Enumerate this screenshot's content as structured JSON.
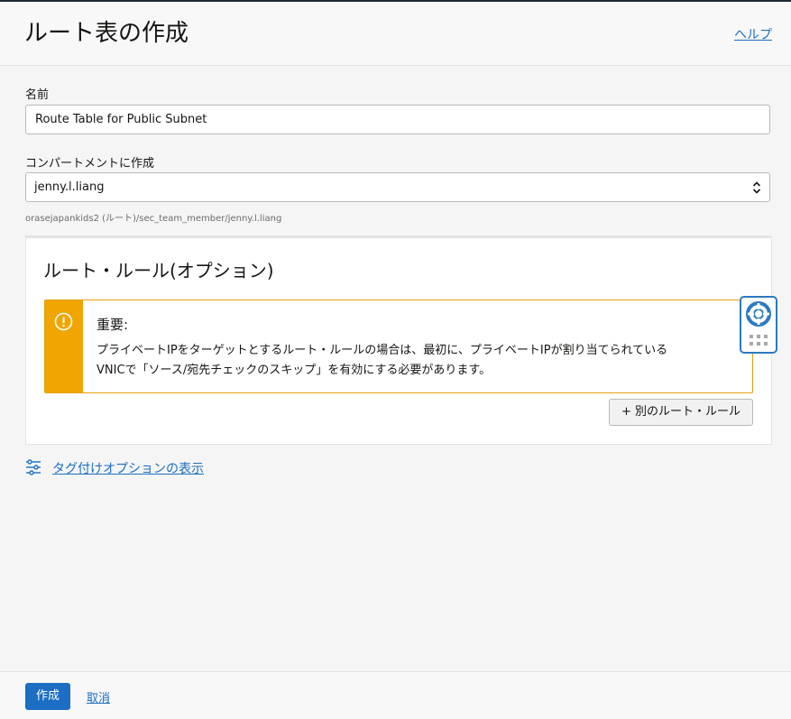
{
  "header": {
    "title": "ルート表の作成",
    "help_label": "ヘルプ"
  },
  "form": {
    "name_label": "名前",
    "name_value": "Route Table for Public Subnet",
    "compartment_label": "コンパートメントに作成",
    "compartment_value": "jenny.l.liang",
    "compartment_path": "orasejapankids2 (ルート)/sec_team_member/jenny.l.liang"
  },
  "route_rules": {
    "title": "ルート・ルール(オプション)",
    "notice": {
      "title": "重要:",
      "line1": "プライベートIPをターゲットとするルート・ルールの場合は、最初に、プライベートIPが割り当てられている",
      "line2": "VNICで「ソース/宛先チェックのスキップ」を有効にする必要があります。"
    },
    "add_rule_label": "+ 別のルート・ルール"
  },
  "tag_options_label": "タグ付けオプションの表示",
  "footer": {
    "create_label": "作成",
    "cancel_label": "取消"
  },
  "icons": {
    "notice": "alert-circle-icon",
    "helper": "lifebuoy-icon",
    "tags": "sliders-icon",
    "select": "chevron-updown-icon"
  },
  "colors": {
    "accent": "#1b6ec2",
    "warning": "#f0a500",
    "page_bg": "#f5f5f5"
  }
}
